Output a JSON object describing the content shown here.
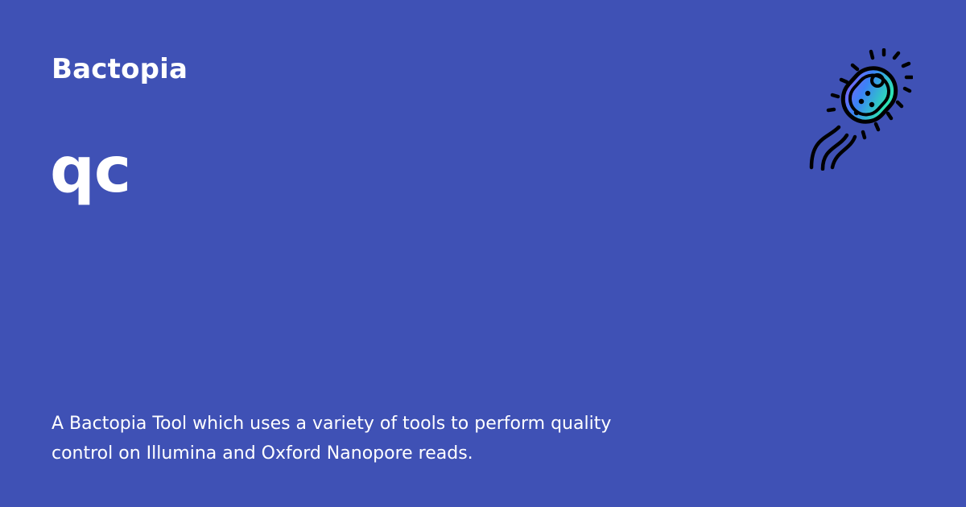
{
  "site": {
    "name": "Bactopia"
  },
  "page": {
    "title": "qc",
    "description": "A Bactopia Tool which uses a variety of tools to perform quality control on Illumina and Oxford Nanopore reads."
  },
  "logo": {
    "icon": "bacterium-icon",
    "gradient_top": "#8a5cf6",
    "gradient_mid": "#3b82f6",
    "gradient_bottom": "#2de3b5",
    "outline": "#000000"
  },
  "colors": {
    "background": "#3f51b5",
    "text": "#ffffff"
  }
}
